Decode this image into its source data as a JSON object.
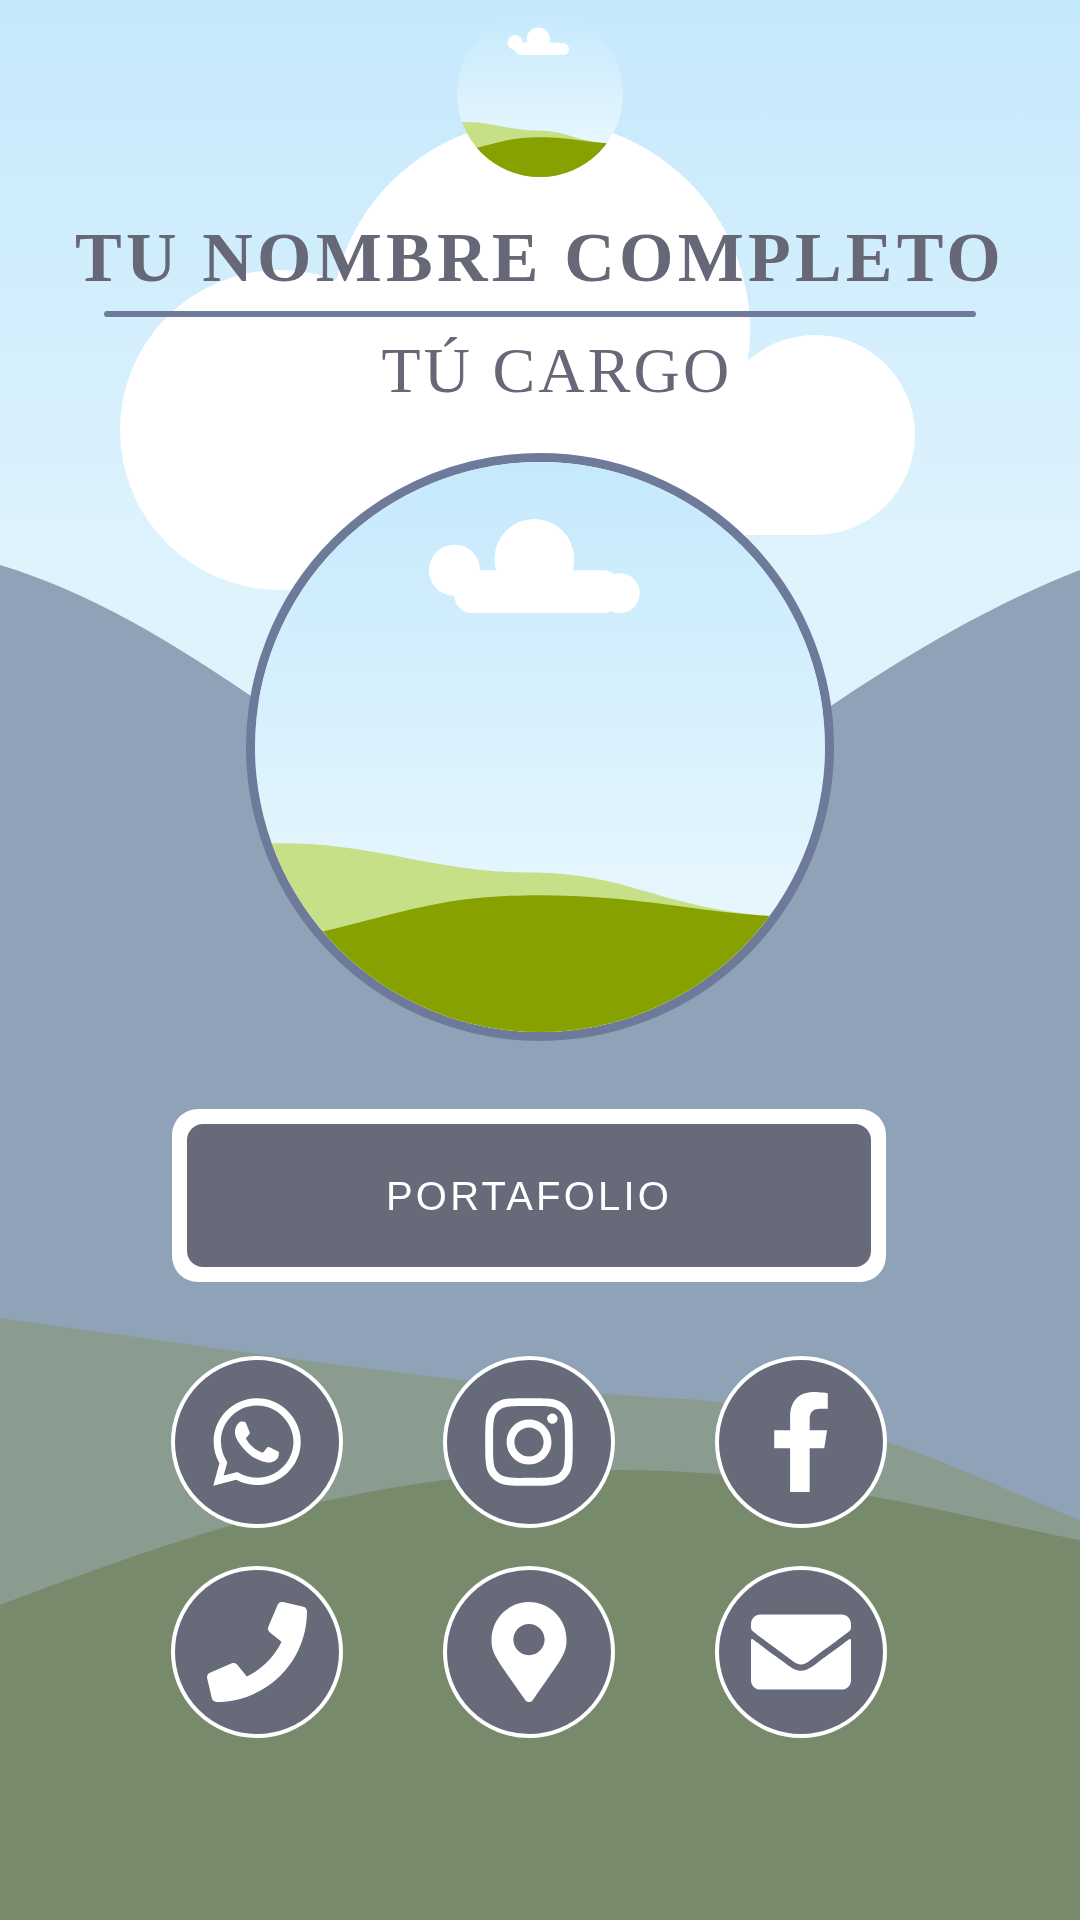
{
  "name": "TU NOMBRE COMPLETO",
  "job_title": "TÚ CARGO",
  "portfolio_button": {
    "label": "PORTAFOLIO"
  },
  "contacts": [
    {
      "kind": "whatsapp"
    },
    {
      "kind": "instagram"
    },
    {
      "kind": "facebook"
    },
    {
      "kind": "phone"
    },
    {
      "kind": "location"
    },
    {
      "kind": "email"
    }
  ]
}
